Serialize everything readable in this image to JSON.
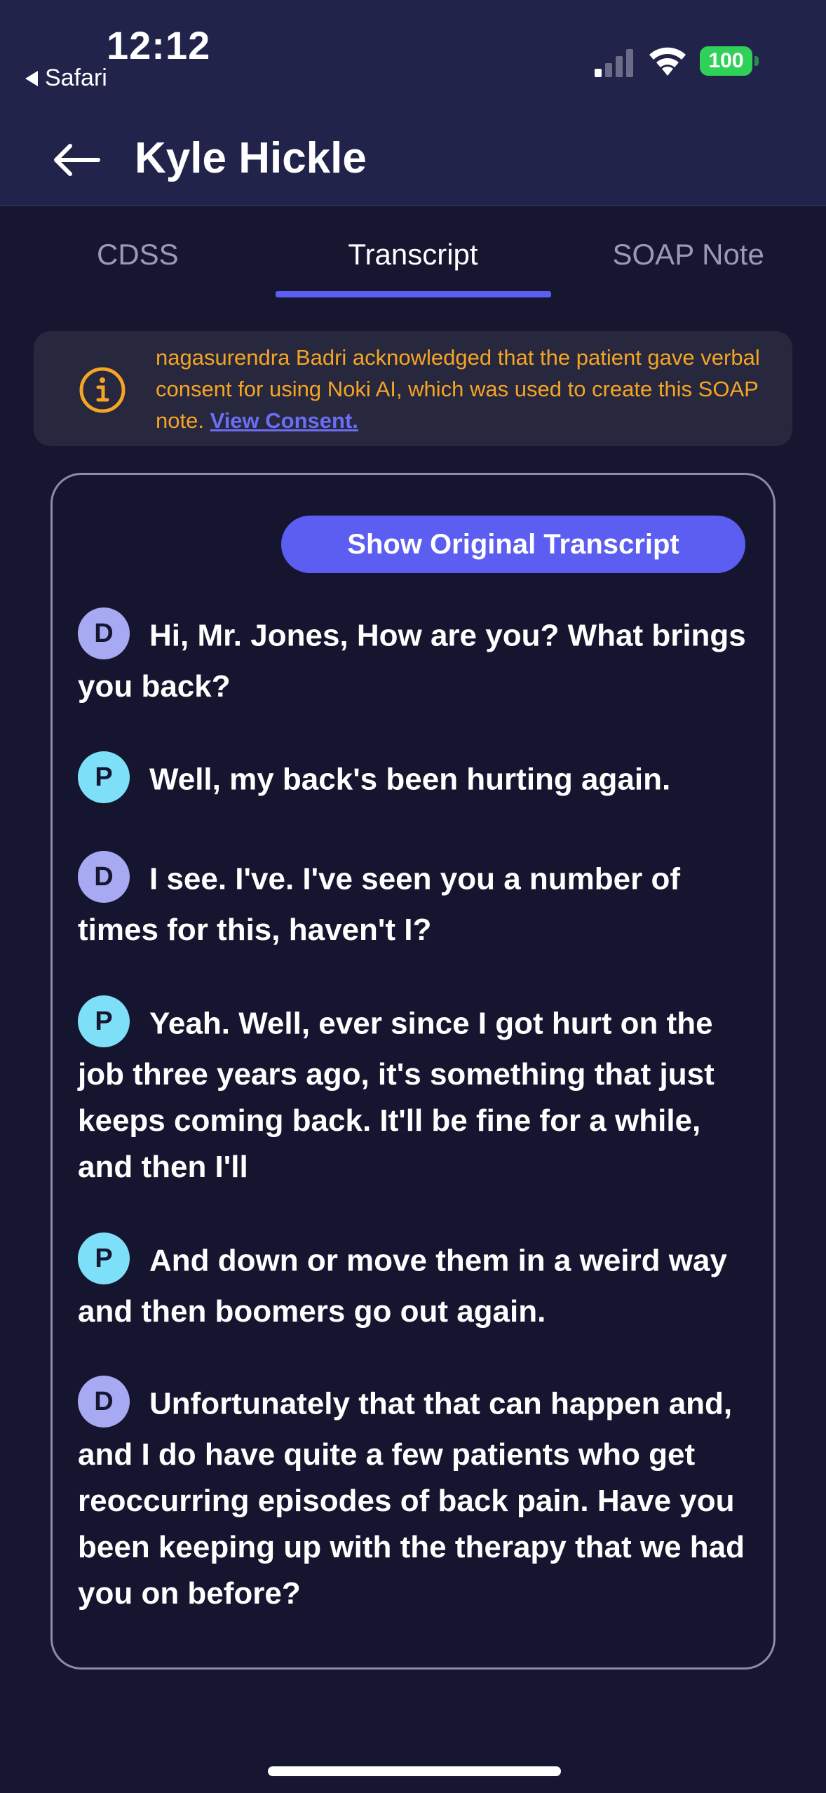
{
  "status_bar": {
    "time": "12:12",
    "back_app": "Safari",
    "battery": "100"
  },
  "header": {
    "title": "Kyle Hickle"
  },
  "tabs": [
    {
      "label": "CDSS",
      "active": false
    },
    {
      "label": "Transcript",
      "active": true
    },
    {
      "label": "SOAP Note",
      "active": false
    }
  ],
  "consent_banner": {
    "text": "nagasurendra Badri acknowledged that the patient gave verbal consent for using Noki AI, which was used to create this SOAP note.",
    "link_text": "View Consent."
  },
  "transcript": {
    "show_original_label": "Show Original Transcript",
    "messages": [
      {
        "speaker": "D",
        "text": "Hi, Mr. Jones, How are you? What brings you back?"
      },
      {
        "speaker": "P",
        "text": "Well, my back's been hurting again."
      },
      {
        "speaker": "D",
        "text": "I see. I've. I've seen you a number of times for this, haven't I?"
      },
      {
        "speaker": "P",
        "text": "Yeah. Well, ever since I got hurt on the job three years ago, it's something that just keeps coming back. It'll be fine for a while, and then I'll"
      },
      {
        "speaker": "P",
        "text": "And down or move them in a weird way and then boomers go out again."
      },
      {
        "speaker": "D",
        "text": "Unfortunately that that can happen and, and I do have quite a few patients who get reoccurring episodes of back pain. Have you been keeping up with the therapy that we had you on before?"
      }
    ]
  },
  "colors": {
    "accent": "#5b5ef0",
    "warning": "#f5a524",
    "doctor_avatar": "#a8a9f3",
    "patient_avatar": "#7ee0f8",
    "battery": "#30d158"
  }
}
